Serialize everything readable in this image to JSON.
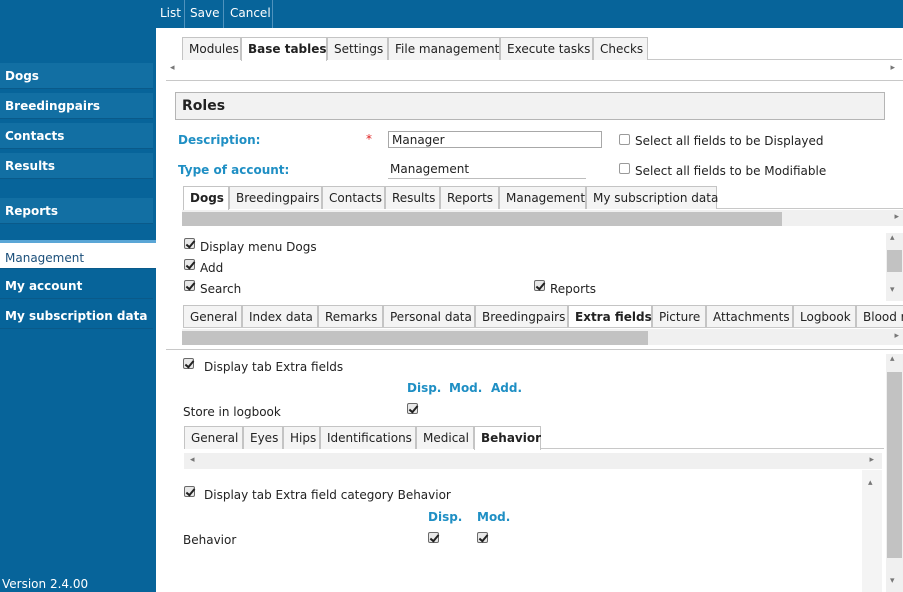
{
  "toolbar": {
    "list": "List",
    "save": "Save",
    "cancel": "Cancel"
  },
  "sidebar": {
    "items": [
      "Dogs",
      "Breedingpairs",
      "Contacts",
      "Results",
      "Reports",
      "Management",
      "My account",
      "My subscription data"
    ],
    "active": "Management",
    "version": "Version 2.4.00"
  },
  "main_tabs": [
    "Modules",
    "Base tables",
    "Settings",
    "File management",
    "Execute tasks",
    "Checks"
  ],
  "main_tabs_active": "Base tables",
  "roles": {
    "title": "Roles",
    "description_label": "Description:",
    "required_mark": "*",
    "description_value": "Manager",
    "type_label": "Type of account:",
    "type_value": "Management",
    "select_displayed": "Select all fields to be Displayed",
    "select_modifiable": "Select all fields to be Modifiable"
  },
  "module_tabs": [
    "Dogs",
    "Breedingpairs",
    "Contacts",
    "Results",
    "Reports",
    "Management",
    "My subscription data"
  ],
  "module_tabs_active": "Dogs",
  "dogs_options": {
    "display_menu": "Display menu Dogs",
    "add": "Add",
    "search": "Search",
    "reports": "Reports"
  },
  "dog_tabs": [
    "General",
    "Index data",
    "Remarks",
    "Personal data",
    "Breedingpairs",
    "Extra fields",
    "Picture",
    "Attachments",
    "Logbook",
    "Blood r"
  ],
  "dog_tabs_active": "Extra fields",
  "extra_fields": {
    "display_tab": "Display tab Extra fields",
    "col_disp": "Disp.",
    "col_mod": "Mod.",
    "col_add": "Add.",
    "store_logbook": "Store in logbook"
  },
  "extra_tabs": [
    "General",
    "Eyes",
    "Hips",
    "Identifications",
    "Medical",
    "Behavior"
  ],
  "extra_tabs_active": "Behavior",
  "behavior": {
    "display_tab": "Display tab Extra field category Behavior",
    "col_disp": "Disp.",
    "col_mod": "Mod.",
    "row_label": "Behavior"
  },
  "icons": {
    "left": "◂",
    "right": "▸",
    "up": "▴",
    "down": "▾"
  }
}
